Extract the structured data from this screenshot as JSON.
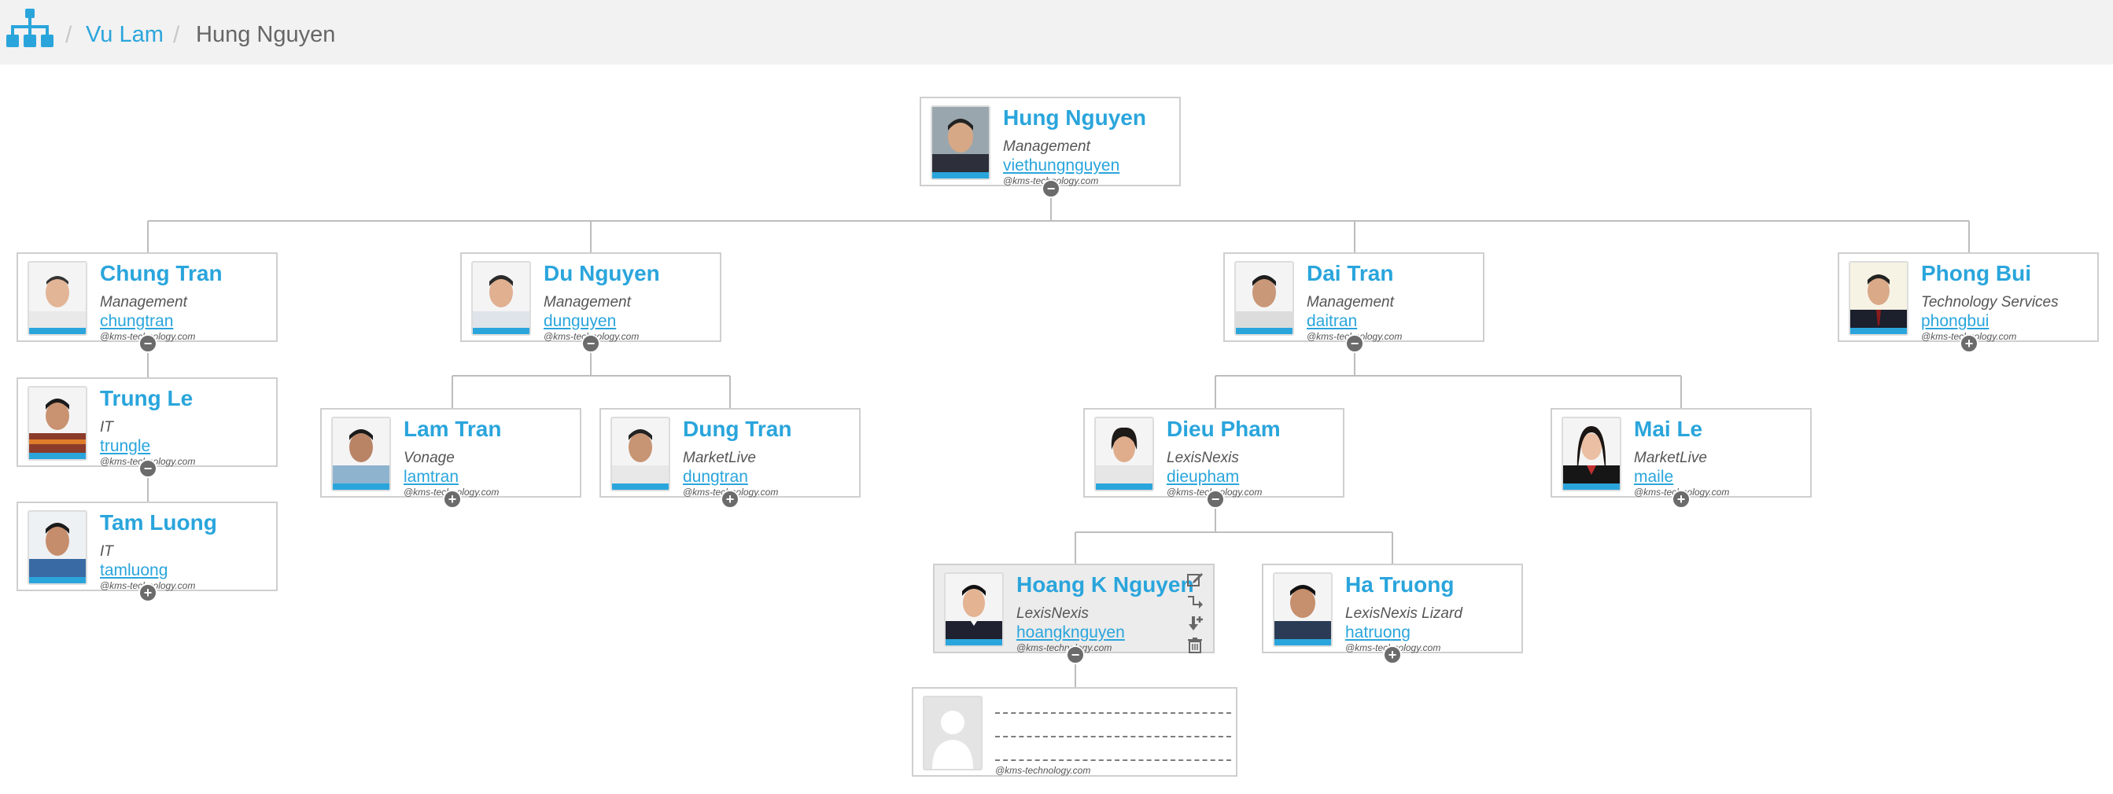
{
  "breadcrumb": {
    "home_icon": "org-chart-icon",
    "separator": "/",
    "items": [
      "Vu Lam",
      "Hung Nguyen"
    ]
  },
  "domain_suffix": "@kms-technology.com",
  "colors": {
    "accent": "#2aa5dc",
    "toggle": "#6b6b6b",
    "border": "#cfcfcf"
  },
  "nodes": {
    "hung": {
      "name": "Hung Nguyen",
      "dept": "Management",
      "user": "viethungnguyen",
      "toggle": "−"
    },
    "chung": {
      "name": "Chung Tran",
      "dept": "Management",
      "user": "chungtran",
      "toggle": "−"
    },
    "du": {
      "name": "Du Nguyen",
      "dept": "Management",
      "user": "dunguyen",
      "toggle": "−"
    },
    "dai": {
      "name": "Dai Tran",
      "dept": "Management",
      "user": "daitran",
      "toggle": "−"
    },
    "phong": {
      "name": "Phong Bui",
      "dept": "Technology Services",
      "user": "phongbui",
      "toggle": "+"
    },
    "trung": {
      "name": "Trung Le",
      "dept": "IT",
      "user": "trungle",
      "toggle": "−"
    },
    "tam": {
      "name": "Tam Luong",
      "dept": "IT",
      "user": "tamluong",
      "toggle": "+"
    },
    "lam": {
      "name": "Lam Tran",
      "dept": "Vonage",
      "user": "lamtran",
      "toggle": "+"
    },
    "dung": {
      "name": "Dung Tran",
      "dept": "MarketLive",
      "user": "dungtran",
      "toggle": "+"
    },
    "dieu": {
      "name": "Dieu Pham",
      "dept": "LexisNexis",
      "user": "dieupham",
      "toggle": "−"
    },
    "mai": {
      "name": "Mai Le",
      "dept": "MarketLive",
      "user": "maile",
      "toggle": "+"
    },
    "hoang": {
      "name": "Hoang K Nguyen",
      "dept": "LexisNexis",
      "user": "hoangknguyen",
      "toggle": "−"
    },
    "ha": {
      "name": "Ha Truong",
      "dept": "LexisNexis Lizard",
      "user": "hatruong",
      "toggle": "+"
    }
  },
  "card_actions": [
    "edit-icon",
    "move-icon",
    "add-child-icon",
    "trash-icon"
  ],
  "placeholder_node": {
    "avatar": "person-silhouette-icon"
  }
}
